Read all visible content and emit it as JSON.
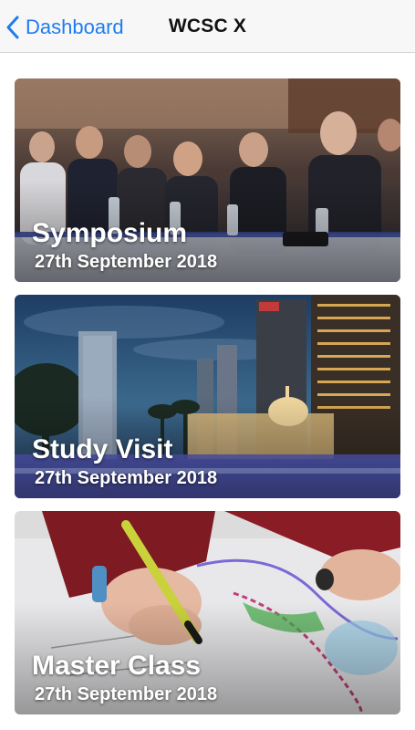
{
  "navbar": {
    "back_label": "Dashboard",
    "title": "WCSC X"
  },
  "events": [
    {
      "title": "Symposium",
      "date": "27th September 2018",
      "image": "conference-audience-photo"
    },
    {
      "title": "Study Visit",
      "date": "27th September 2018",
      "image": "city-skyline-night-photo"
    },
    {
      "title": "Master Class",
      "date": "27th September 2018",
      "image": "hands-drawing-map-photo"
    }
  ],
  "colors": {
    "accent": "#1e7cf2",
    "navbar_bg": "#f7f7f7",
    "card_text": "#ffffff"
  }
}
